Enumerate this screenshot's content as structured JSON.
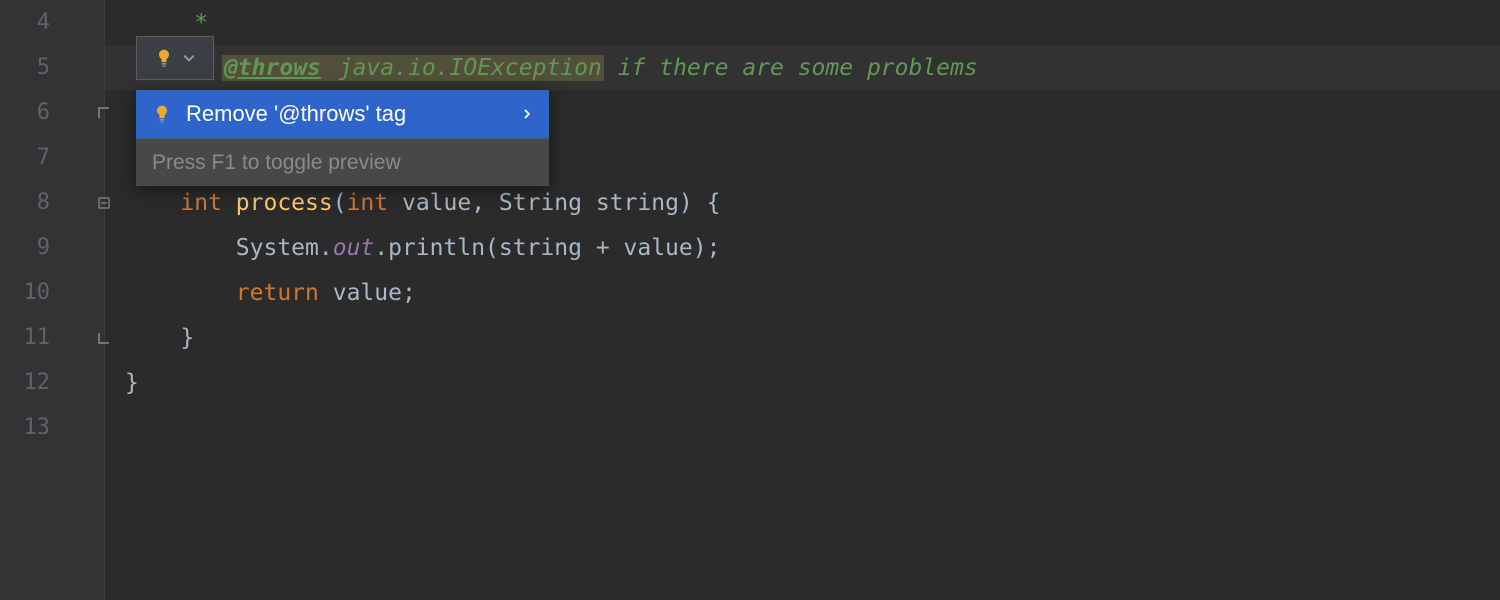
{
  "gutter": {
    "lines": [
      "4",
      "5",
      "6",
      "7",
      "8",
      "9",
      "10",
      "11",
      "12",
      "13"
    ]
  },
  "code": {
    "line4_star": "*",
    "line5_star": "* ",
    "line5_tag": "@throws",
    "line5_link": " java.io.IOException",
    "line5_rest": " if there are some problems",
    "line6_indent": "    ",
    "line7_indent": "    ",
    "line8_indent": "    ",
    "line8_kw1": "int ",
    "line8_method": "process",
    "line8_paren_open": "(",
    "line8_kw2": "int ",
    "line8_params": "value, String string) {",
    "line9_indent": "        ",
    "line9_sys": "System.",
    "line9_out": "out",
    "line9_rest": ".println(string + value);",
    "line10_indent": "        ",
    "line10_kw": "return ",
    "line10_rest": "value;",
    "line11_indent": "    ",
    "line11_brace": "}",
    "line12_brace": "}"
  },
  "popup": {
    "action_label": "Remove '@throws' tag",
    "hint": "Press F1 to toggle preview"
  }
}
